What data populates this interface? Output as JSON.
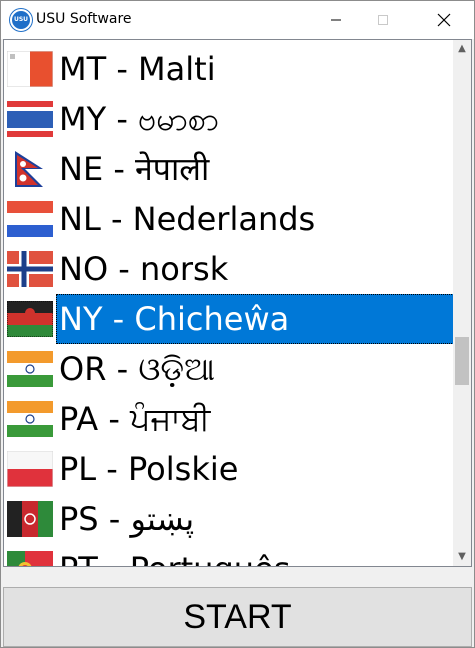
{
  "window": {
    "title": "USU Software",
    "icon_text": "USU"
  },
  "title_controls": {
    "minimize_glyph": "—",
    "maximize_glyph": "☐",
    "close_glyph": "✕"
  },
  "languages": [
    {
      "label": "MT - Malti",
      "flag": "malta-flag"
    },
    {
      "label": "MY - ဗမာစာ",
      "flag": "myanmar-flag"
    },
    {
      "label": "NE - नेपाली",
      "flag": "nepal-flag"
    },
    {
      "label": "NL - Nederlands",
      "flag": "netherlands-flag"
    },
    {
      "label": "NO - norsk",
      "flag": "norway-flag"
    },
    {
      "label": "NY - Chicheŵa",
      "flag": "malawi-flag",
      "selected": true
    },
    {
      "label": "OR - ଓଡ଼ିଆ",
      "flag": "india-flag"
    },
    {
      "label": "PA - ਪੰਜਾਬੀ",
      "flag": "india-flag"
    },
    {
      "label": "PL - Polskie",
      "flag": "poland-flag"
    },
    {
      "label": "PS - پښتو",
      "flag": "afghanistan-flag"
    },
    {
      "label": "PT - Português",
      "flag": "portugal-flag"
    }
  ],
  "scrollbar": {
    "up_glyph": "▲",
    "down_glyph": "▼"
  },
  "start_button": {
    "label": "START"
  },
  "colors": {
    "selection": "#0078d7",
    "window_bg": "#f0f0f0"
  }
}
